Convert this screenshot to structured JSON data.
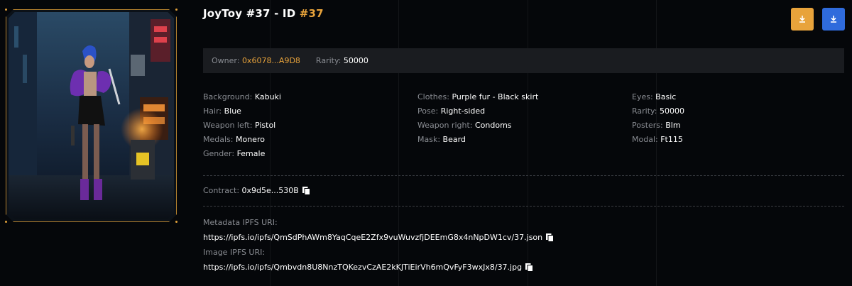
{
  "title": {
    "text": "JoyToy #37 - ID ",
    "id": "#37"
  },
  "buttons": {
    "download_orange_icon": "download-icon",
    "download_blue_icon": "download-icon"
  },
  "owner": {
    "label": "Owner:",
    "value": "0x6078...A9D8"
  },
  "rarity_bar": {
    "label": "Rarity:",
    "value": "50000"
  },
  "attributes": [
    {
      "label": "Background:",
      "value": "Kabuki"
    },
    {
      "label": "Hair:",
      "value": "Blue"
    },
    {
      "label": "Weapon left:",
      "value": "Pistol"
    },
    {
      "label": "Medals:",
      "value": "Monero"
    },
    {
      "label": "Gender:",
      "value": "Female"
    },
    {
      "label": "Clothes:",
      "value": "Purple fur - Black skirt"
    },
    {
      "label": "Pose:",
      "value": "Right-sided"
    },
    {
      "label": "Weapon right:",
      "value": "Condoms"
    },
    {
      "label": "Mask:",
      "value": "Beard"
    },
    {
      "label": "Eyes:",
      "value": "Basic"
    },
    {
      "label": "Rarity:",
      "value": "50000"
    },
    {
      "label": "Posters:",
      "value": "Blm"
    },
    {
      "label": "Modal:",
      "value": "Ft115"
    }
  ],
  "contract": {
    "label": "Contract:",
    "value": "0x9d5e...530B"
  },
  "metadata": {
    "label": "Metadata IPFS URI:",
    "value": "https://ipfs.io/ipfs/QmSdPhAWm8YaqCqeE2Zfx9vuWuvzfjDEEmG8x4nNpDW1cv/37.json"
  },
  "image": {
    "label": "Image IPFS URI:",
    "value": "https://ipfs.io/ipfs/Qmbvdn8U8NnzTQKezvCzAE2kKJTiEirVh6mQvFyF3wxJx8/37.jpg"
  },
  "colors": {
    "accent": "#e8a33b",
    "blue_button": "#2f6bdc",
    "background": "#05070a",
    "bar": "#1a1c20"
  }
}
